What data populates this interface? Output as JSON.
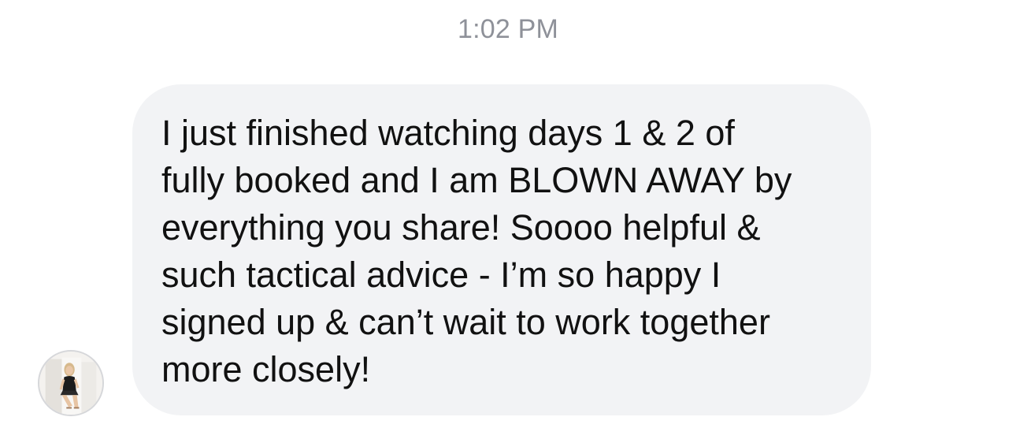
{
  "conversation": {
    "timestamp": "1:02 PM",
    "messages": [
      {
        "direction": "incoming",
        "avatar_icon": "user-avatar-photo",
        "text": "I just finished watching days 1 & 2 of\nfully booked and I am BLOWN AWAY by\neverything you share! Soooo helpful &\nsuch tactical advice - I’m so happy I\nsigned up & can’t wait to work together\nmore closely!"
      }
    ]
  },
  "colors": {
    "background": "#ffffff",
    "bubble": "#f2f3f5",
    "timestamp": "#8e9199",
    "message_text": "#111111"
  }
}
